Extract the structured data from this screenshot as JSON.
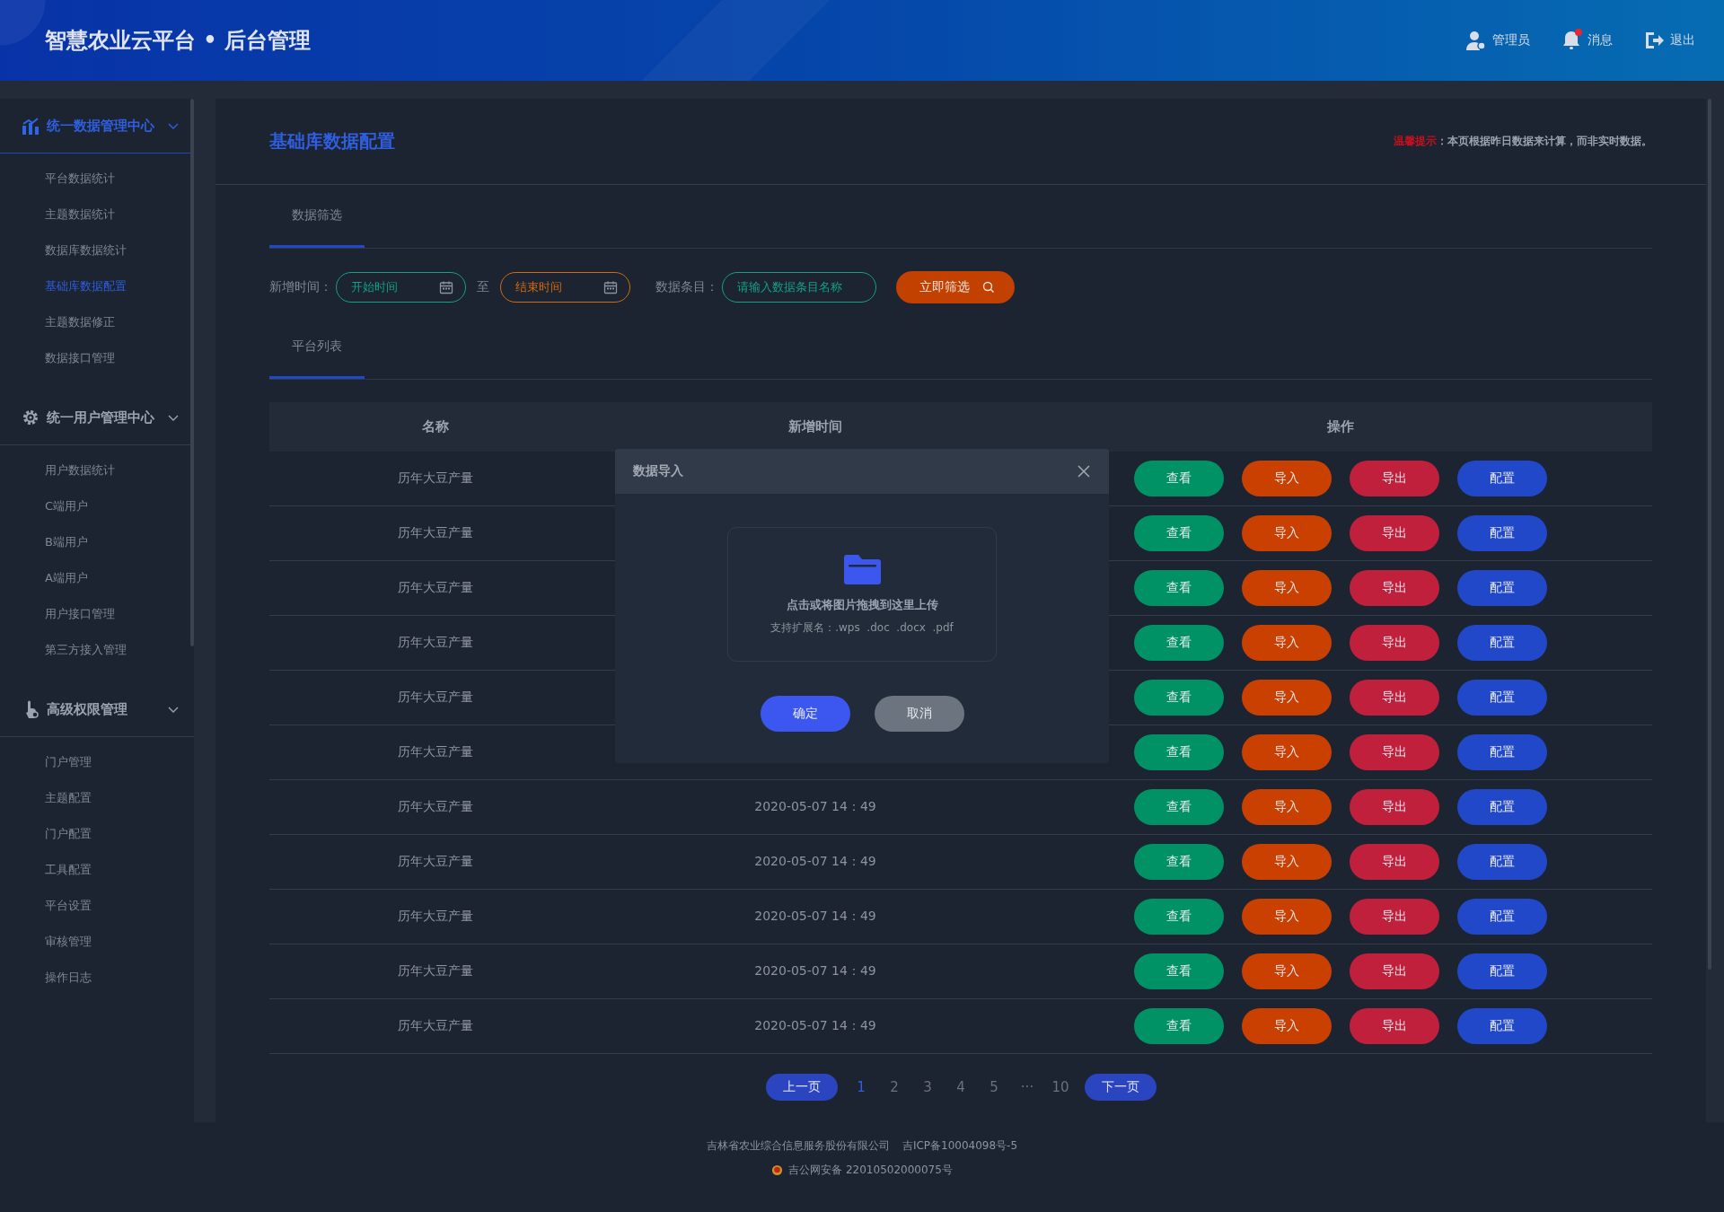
{
  "header": {
    "title": "智慧农业云平台 • 后台管理",
    "actions": [
      {
        "label": "管理员",
        "kind": "user",
        "unread": false
      },
      {
        "label": "消息",
        "kind": "bell",
        "unread": true
      },
      {
        "label": "退出",
        "kind": "logout",
        "unread": false
      }
    ]
  },
  "sidebar": {
    "groups": [
      {
        "title": "统一数据管理中心",
        "kind": "chart",
        "expanded": true,
        "selected": true,
        "items": [
          {
            "label": "平台数据统计",
            "selected": false
          },
          {
            "label": "主题数据统计",
            "selected": false
          },
          {
            "label": "数据库数据统计",
            "selected": false
          },
          {
            "label": "基础库数据配置",
            "selected": true
          },
          {
            "label": "主题数据修正",
            "selected": false
          },
          {
            "label": "数据接口管理",
            "selected": false
          }
        ]
      },
      {
        "title": "统一用户管理中心",
        "kind": "gear",
        "expanded": true,
        "selected": false,
        "items": [
          {
            "label": "用户数据统计",
            "selected": false
          },
          {
            "label": "C端用户",
            "selected": false
          },
          {
            "label": "B端用户",
            "selected": false
          },
          {
            "label": "A端用户",
            "selected": false
          },
          {
            "label": "用户接口管理",
            "selected": false
          },
          {
            "label": "第三方接入管理",
            "selected": false
          }
        ]
      },
      {
        "title": "高级权限管理",
        "kind": "hand",
        "expanded": true,
        "selected": false,
        "items": [
          {
            "label": "门户管理",
            "selected": false
          },
          {
            "label": "主题配置",
            "selected": false
          },
          {
            "label": "门户配置",
            "selected": false
          },
          {
            "label": "工具配置",
            "selected": false
          },
          {
            "label": "平台设置",
            "selected": false
          },
          {
            "label": "审核管理",
            "selected": false
          },
          {
            "label": "操作日志",
            "selected": false
          }
        ]
      }
    ]
  },
  "page": {
    "title": "基础库数据配置",
    "notice": {
      "label": "温馨提示",
      "text": "：本页根据昨日数据来计算，而非实时数据。"
    }
  },
  "filter_tabs": [
    {
      "label": "数据筛选",
      "selected": true
    }
  ],
  "filters": {
    "date_label": "新增时间：",
    "start": {
      "placeholder": "开始时间"
    },
    "separator": "至",
    "end": {
      "placeholder": "结束时间"
    },
    "item_label": "数据条目：",
    "item": {
      "placeholder": "请输入数据条目名称"
    },
    "button": "立即筛选"
  },
  "list_tabs": [
    {
      "label": "平台列表",
      "selected": true
    }
  ],
  "table": {
    "columns": [
      "名称",
      "新增时间",
      "操作"
    ],
    "rows": [
      {
        "name": "历年大豆产量",
        "actions": [
          {
            "label": "查看",
            "kind": "view"
          },
          {
            "label": "导入",
            "kind": "import"
          },
          {
            "label": "导出",
            "kind": "export"
          },
          {
            "label": "配置",
            "kind": "config"
          }
        ]
      },
      {
        "name": "历年大豆产量",
        "actions": [
          {
            "label": "查看",
            "kind": "view"
          },
          {
            "label": "导入",
            "kind": "import"
          },
          {
            "label": "导出",
            "kind": "export"
          },
          {
            "label": "配置",
            "kind": "config"
          }
        ]
      },
      {
        "name": "历年大豆产量",
        "actions": [
          {
            "label": "查看",
            "kind": "view"
          },
          {
            "label": "导入",
            "kind": "import"
          },
          {
            "label": "导出",
            "kind": "export"
          },
          {
            "label": "配置",
            "kind": "config"
          }
        ]
      },
      {
        "name": "历年大豆产量",
        "actions": [
          {
            "label": "查看",
            "kind": "view"
          },
          {
            "label": "导入",
            "kind": "import"
          },
          {
            "label": "导出",
            "kind": "export"
          },
          {
            "label": "配置",
            "kind": "config"
          }
        ]
      },
      {
        "name": "历年大豆产量",
        "actions": [
          {
            "label": "查看",
            "kind": "view"
          },
          {
            "label": "导入",
            "kind": "import"
          },
          {
            "label": "导出",
            "kind": "export"
          },
          {
            "label": "配置",
            "kind": "config"
          }
        ]
      },
      {
        "name": "历年大豆产量",
        "actions": [
          {
            "label": "查看",
            "kind": "view"
          },
          {
            "label": "导入",
            "kind": "import"
          },
          {
            "label": "导出",
            "kind": "export"
          },
          {
            "label": "配置",
            "kind": "config"
          }
        ]
      },
      {
        "name": "历年大豆产量",
        "date": "2020-05-07 14：49",
        "actions": [
          {
            "label": "查看",
            "kind": "view"
          },
          {
            "label": "导入",
            "kind": "import"
          },
          {
            "label": "导出",
            "kind": "export"
          },
          {
            "label": "配置",
            "kind": "config"
          }
        ]
      },
      {
        "name": "历年大豆产量",
        "date": "2020-05-07 14：49",
        "actions": [
          {
            "label": "查看",
            "kind": "view"
          },
          {
            "label": "导入",
            "kind": "import"
          },
          {
            "label": "导出",
            "kind": "export"
          },
          {
            "label": "配置",
            "kind": "config"
          }
        ]
      },
      {
        "name": "历年大豆产量",
        "date": "2020-05-07 14：49",
        "actions": [
          {
            "label": "查看",
            "kind": "view"
          },
          {
            "label": "导入",
            "kind": "import"
          },
          {
            "label": "导出",
            "kind": "export"
          },
          {
            "label": "配置",
            "kind": "config"
          }
        ]
      },
      {
        "name": "历年大豆产量",
        "date": "2020-05-07 14：49",
        "actions": [
          {
            "label": "查看",
            "kind": "view"
          },
          {
            "label": "导入",
            "kind": "import"
          },
          {
            "label": "导出",
            "kind": "export"
          },
          {
            "label": "配置",
            "kind": "config"
          }
        ]
      },
      {
        "name": "历年大豆产量",
        "date": "2020-05-07 14：49",
        "actions": [
          {
            "label": "查看",
            "kind": "view"
          },
          {
            "label": "导入",
            "kind": "import"
          },
          {
            "label": "导出",
            "kind": "export"
          },
          {
            "label": "配置",
            "kind": "config"
          }
        ]
      }
    ]
  },
  "pagination": {
    "prev": "上一页",
    "pages": [
      {
        "label": "1",
        "selected": true
      },
      {
        "label": "2",
        "selected": false
      },
      {
        "label": "3",
        "selected": false
      },
      {
        "label": "4",
        "selected": false
      },
      {
        "label": "5",
        "selected": false
      },
      {
        "label": "···",
        "selected": false
      },
      {
        "label": "10",
        "selected": false
      }
    ],
    "next": "下一页"
  },
  "modal": {
    "title": "数据导入",
    "upload_title": "点击或将图片拖拽到这里上传",
    "upload_hint": "支持扩展名：.wps  .doc  .docx  .pdf",
    "buttons": [
      {
        "label": "确定",
        "kind": "primary"
      },
      {
        "label": "取消",
        "kind": "secondary"
      }
    ]
  },
  "footer": {
    "company": "吉林省农业综合信息服务股份有限公司",
    "icp": "吉ICP备10004098号-5",
    "police": "吉公网安备 22010502000075号"
  }
}
